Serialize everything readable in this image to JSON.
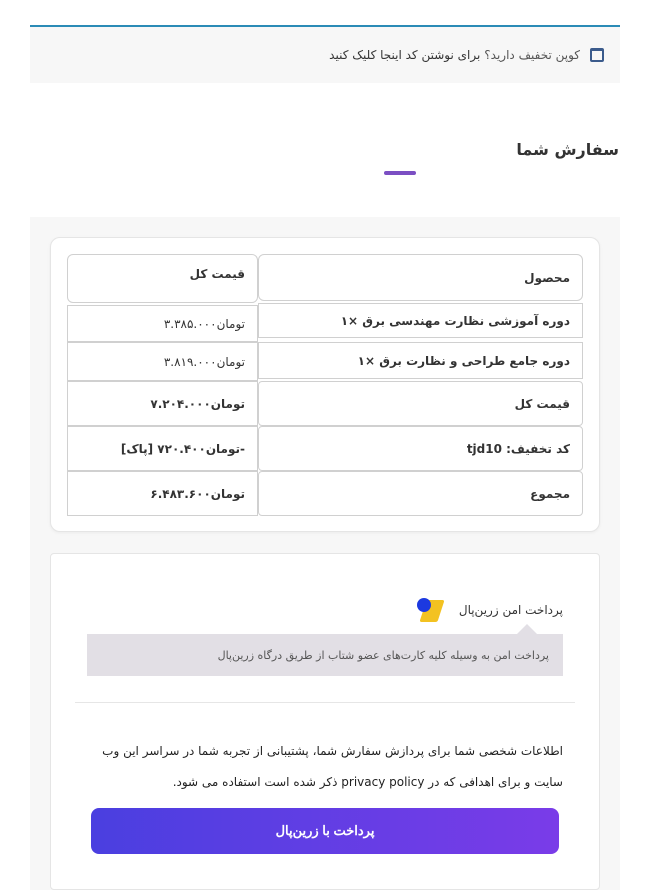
{
  "coupon": {
    "question": "کوپن تخفیف دارید؟",
    "link_text": "برای نوشتن کد اینجا کلیک کنید"
  },
  "order_section": {
    "title": "سفارش شما"
  },
  "order_table": {
    "headers": {
      "product": "محصول",
      "total": "قیمت کل"
    },
    "items": [
      {
        "name": "دوره آموزشی نظارت مهندسی برق ×۱",
        "price": "تومان۳.۳۸۵.۰۰۰"
      },
      {
        "name": "دوره جامع طراحی و نظارت برق ×۱",
        "price": "تومان۳.۸۱۹.۰۰۰"
      }
    ],
    "subtotal": {
      "label": "قیمت کل",
      "value": "تومان۷.۲۰۴.۰۰۰"
    },
    "discount": {
      "label": "کد تخفیف: tjd10",
      "value": "-تومان۷۲۰.۴۰۰ [پاک]"
    },
    "grand_total": {
      "label": "مجموع",
      "value": "تومان۶.۴۸۳.۶۰۰"
    }
  },
  "payment": {
    "method_label": "پرداخت امن زرین‌پال",
    "method_icon": "zarinpal-logo",
    "description": "پرداخت امن به وسیله کلیه کارت‌های عضو شتاب از طریق درگاه زرین‌پال",
    "privacy_before": "اطلاعات شخصی شما برای پردازش سفارش شما، پشتیبانی از تجربه شما در سراسر این وب سایت و برای اهدافی که در ",
    "privacy_link": "privacy policy",
    "privacy_after": " ذکر شده است استفاده می شود.",
    "submit_label": "پرداخت با زرین‌پال"
  },
  "colors": {
    "accent_purple": "#7b4fc3",
    "coupon_border": "#2b8bb6",
    "button_gradient_start": "#4a3fe0",
    "button_gradient_end": "#7a3ce8"
  }
}
